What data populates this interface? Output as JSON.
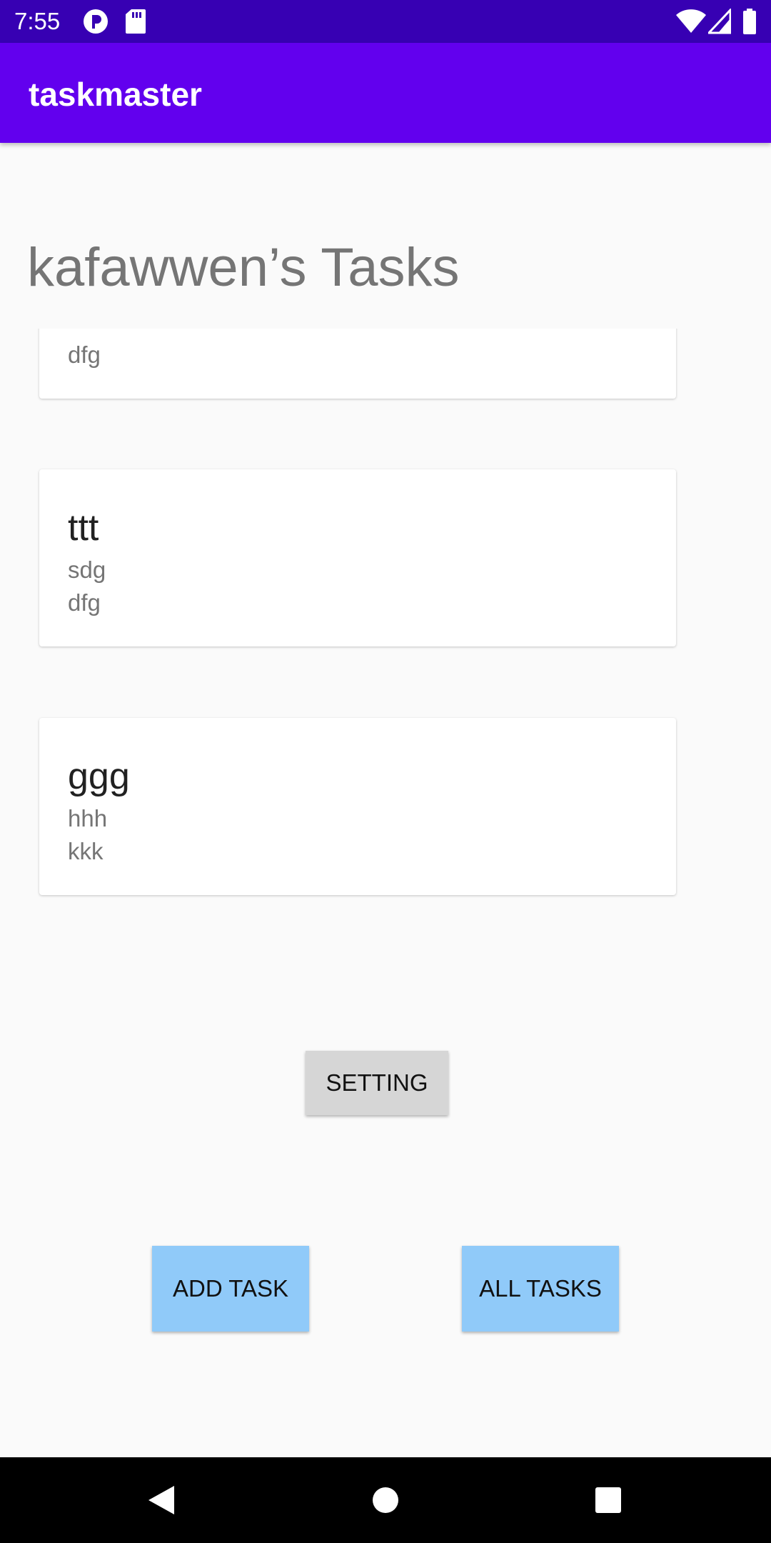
{
  "status_bar": {
    "time": "7:55",
    "left_icons": [
      "pocket-icon",
      "sd-card-icon"
    ],
    "right_icons": [
      "wifi-icon",
      "cell-signal-icon",
      "battery-icon"
    ]
  },
  "app_bar": {
    "title": "taskmaster"
  },
  "heading": "kafawwen’s Tasks",
  "tasks": [
    {
      "title": "",
      "body": "",
      "state": "dfg"
    },
    {
      "title": "ttt",
      "body": "sdg",
      "state": "dfg"
    },
    {
      "title": "ggg",
      "body": "hhh",
      "state": "kkk"
    }
  ],
  "buttons": {
    "setting": "SETTING",
    "add_task": "ADD TASK",
    "all_tasks": "ALL TASKS"
  },
  "colors": {
    "status_bar": "#3700b3",
    "app_bar": "#6200ee",
    "action_button": "#90caf9",
    "setting_button": "#d6d6d6"
  },
  "nav_bar": {
    "icons": [
      "back-icon",
      "home-icon",
      "recents-icon"
    ]
  }
}
